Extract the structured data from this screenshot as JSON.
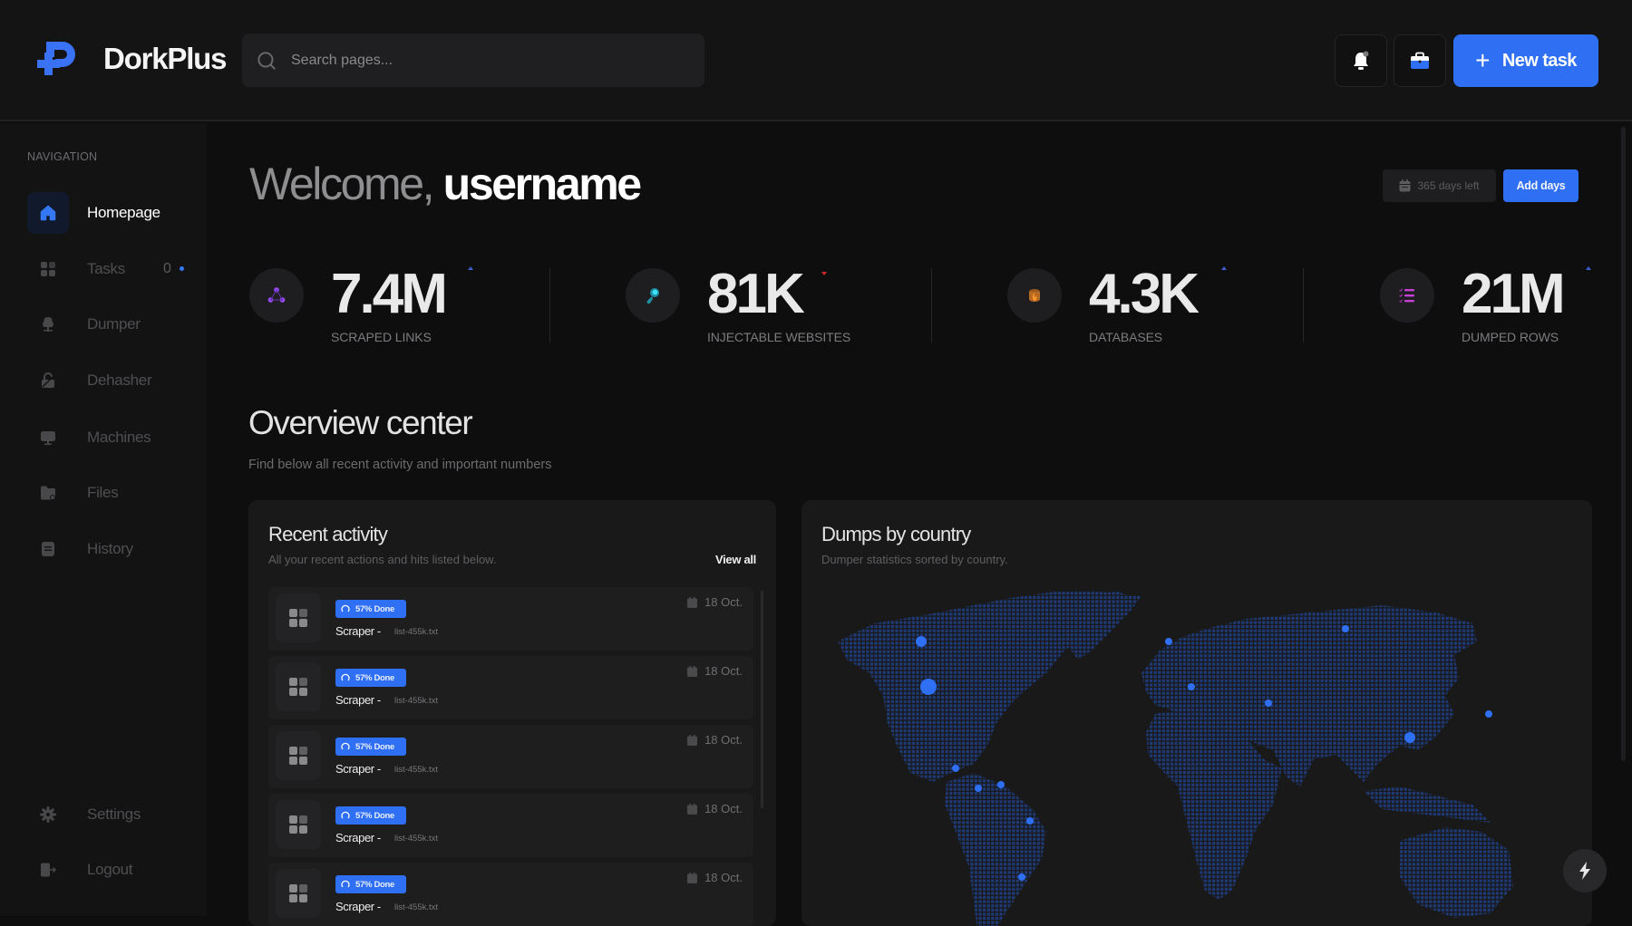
{
  "header": {
    "brand": "DorkPlus",
    "search_placeholder": "Search pages...",
    "new_task_label": "New task",
    "icons": {
      "logo": "dorkplus-logo",
      "search": "search-icon",
      "bell": "bell-icon",
      "briefcase": "briefcase-icon",
      "plus": "plus-icon"
    }
  },
  "sidebar": {
    "section_label": "NAVIGATION",
    "items": [
      {
        "label": "Homepage",
        "icon": "home-icon",
        "active": true
      },
      {
        "label": "Tasks",
        "icon": "grid-icon",
        "count": "0"
      },
      {
        "label": "Dumper",
        "icon": "tree-icon"
      },
      {
        "label": "Dehasher",
        "icon": "unlock-icon"
      },
      {
        "label": "Machines",
        "icon": "monitor-icon"
      },
      {
        "label": "Files",
        "icon": "folder-icon"
      },
      {
        "label": "History",
        "icon": "document-icon"
      }
    ],
    "bottom_items": [
      {
        "label": "Settings",
        "icon": "gear-icon"
      },
      {
        "label": "Logout",
        "icon": "logout-icon"
      }
    ]
  },
  "welcome": {
    "greeting": "Welcome,",
    "username": "username"
  },
  "subscription": {
    "days_left": "365 days left",
    "add_days_label": "Add days"
  },
  "stats": [
    {
      "value": "7.4M",
      "label": "SCRAPED LINKS",
      "trend": "up",
      "icon": "network-icon",
      "color": "#9b4dff"
    },
    {
      "value": "81K",
      "label": "INJECTABLE WEBSITES",
      "trend": "down",
      "icon": "syringe-icon",
      "color": "#29c6e0"
    },
    {
      "value": "4.3K",
      "label": "DATABASES",
      "trend": "up",
      "icon": "database-fire-icon",
      "color": "#f08a24"
    },
    {
      "value": "21M",
      "label": "DUMPED ROWS",
      "trend": "up",
      "icon": "checklist-icon",
      "color": "#c940d8"
    }
  ],
  "overview": {
    "title": "Overview center",
    "subtitle": "Find below all recent activity and important numbers"
  },
  "recent_activity": {
    "title": "Recent activity",
    "subtitle": "All your recent actions and hits listed below.",
    "view_all_label": "View all",
    "items": [
      {
        "status": "57% Done",
        "progress": 57,
        "name": "Scraper -",
        "file": "list-455k.txt",
        "date": "18 Oct."
      },
      {
        "status": "57% Done",
        "progress": 57,
        "name": "Scraper -",
        "file": "list-455k.txt",
        "date": "18 Oct."
      },
      {
        "status": "57% Done",
        "progress": 57,
        "name": "Scraper -",
        "file": "list-455k.txt",
        "date": "18 Oct."
      },
      {
        "status": "57% Done",
        "progress": 57,
        "name": "Scraper -",
        "file": "list-455k.txt",
        "date": "18 Oct."
      },
      {
        "status": "57% Done",
        "progress": 57,
        "name": "Scraper -",
        "file": "list-455k.txt",
        "date": "18 Oct."
      }
    ]
  },
  "dumps_by_country": {
    "title": "Dumps by country",
    "subtitle": "Dumper statistics sorted by country.",
    "markers": [
      {
        "region": "Canada",
        "size": "medium"
      },
      {
        "region": "United States",
        "size": "large"
      },
      {
        "region": "Central America",
        "size": "small"
      },
      {
        "region": "Colombia",
        "size": "small"
      },
      {
        "region": "Venezuela",
        "size": "small"
      },
      {
        "region": "Brazil",
        "size": "small"
      },
      {
        "region": "Argentina",
        "size": "small"
      },
      {
        "region": "United Kingdom",
        "size": "small"
      },
      {
        "region": "Italy",
        "size": "small"
      },
      {
        "region": "Iran",
        "size": "small"
      },
      {
        "region": "Russia",
        "size": "small"
      },
      {
        "region": "China",
        "size": "medium"
      },
      {
        "region": "Japan",
        "size": "small"
      }
    ],
    "colors": {
      "land": "#1e3a78",
      "marker": "#2f6ff3"
    }
  },
  "fab_icon": "lightning-icon",
  "accent_color": "#2f6ff3"
}
